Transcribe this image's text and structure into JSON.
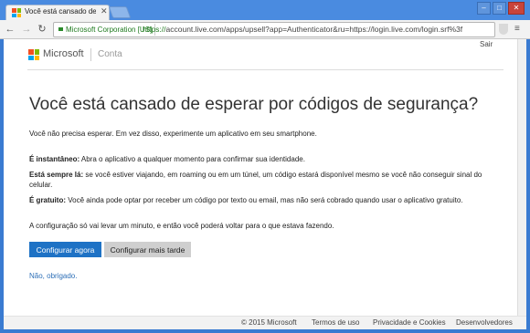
{
  "browser": {
    "tab_title": "Você está cansado de esp",
    "ev_label": "Microsoft Corporation [US]",
    "url_scheme": "https://",
    "url_rest": "account.live.com/apps/upsell?app=Authenticator&ru=https://login.live.com/login.srf%3f"
  },
  "header": {
    "brand": "Microsoft",
    "section": "Conta",
    "signout": "Sair"
  },
  "main": {
    "title": "Você está cansado de esperar por códigos de segurança?",
    "intro": "Você não precisa esperar. Em vez disso, experimente um aplicativo em seu smartphone.",
    "p1_bold": "É instantâneo:",
    "p1_text": " Abra o aplicativo a qualquer momento para confirmar sua identidade.",
    "p2_bold": "Está sempre lá:",
    "p2_text": " se você estiver viajando, em roaming ou em um túnel, um código estará disponível mesmo se você não conseguir sinal do celular.",
    "p3_bold": "É gratuito:",
    "p3_text": " Você ainda pode optar por receber um código por texto ou email, mas não será cobrado quando usar o aplicativo gratuito.",
    "setup_text": "A configuração só vai levar um minuto, e então você poderá voltar para o que estava fazendo.",
    "btn_now": "Configurar agora",
    "btn_later": "Configurar mais tarde",
    "link_no": "Não, obrigado."
  },
  "footer": {
    "copyright": "© 2015 Microsoft",
    "terms": "Termos de uso",
    "privacy": "Privacidade e Cookies",
    "developers": "Desenvolvedores"
  },
  "colors": {
    "accent": "#1e72c5",
    "link": "#2d6fb7"
  }
}
